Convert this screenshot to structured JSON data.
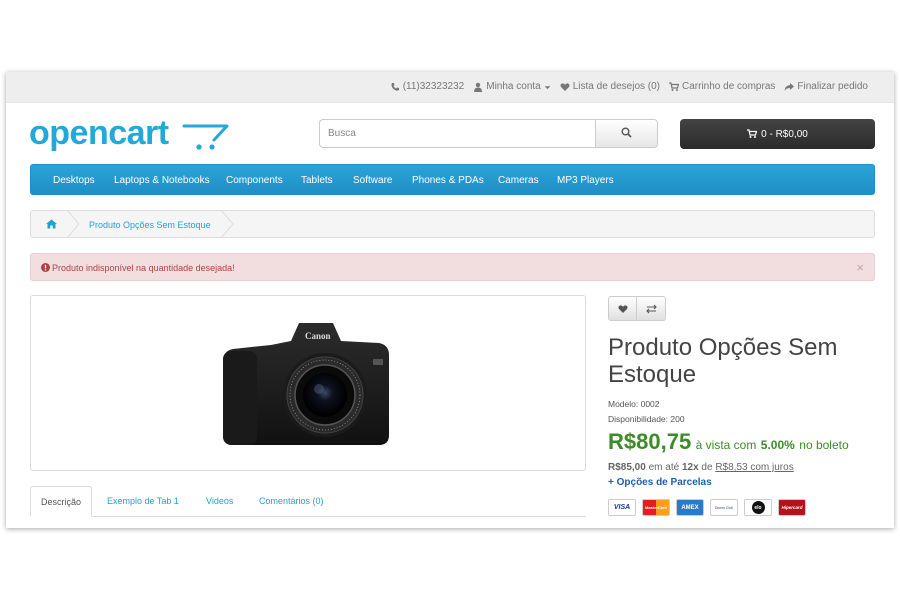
{
  "topbar": {
    "phone": "(11)32323232",
    "account": "Minha conta",
    "wishlist": "Lista de desejos (0)",
    "cart": "Carrinho de compras",
    "checkout": "Finalizar pedido"
  },
  "header": {
    "logo_text": "opencart",
    "search_placeholder": "Busca",
    "cart_button": "0 - R$0,00"
  },
  "menu": {
    "items": [
      "Desktops",
      "Laptops & Notebooks",
      "Components",
      "Tablets",
      "Software",
      "Phones & PDAs",
      "Cameras",
      "MP3 Players"
    ]
  },
  "breadcrumb": {
    "current": "Produto Opções Sem Estoque"
  },
  "alert": {
    "message": "Produto indisponível na quantidade desejada!",
    "close": "×"
  },
  "tabs": [
    "Descrição",
    "Exemplo de Tab 1",
    "Videos",
    "Comentários (0)"
  ],
  "product": {
    "title": "Produto Opções Sem Estoque",
    "model": "Modelo: 0002",
    "availability": "Disponibilidade: 200",
    "price": "R$80,75",
    "price_note_a": "à vista com",
    "price_note_pct": "5.00%",
    "price_note_b": "no boleto",
    "old_price": "R$85,00",
    "inst_a": "em até",
    "inst_count": "12x",
    "inst_b": "de",
    "inst_value": "R$8,53 com juros",
    "options_link": "+ Opções de Parcelas",
    "camera_brand": "Canon"
  },
  "cards": [
    "VISA",
    "MasterCard",
    "AMEX",
    "Diners Club",
    "elo",
    "Hipercard"
  ],
  "colors": {
    "menu": "#229ac8",
    "link": "#23a1d1",
    "price": "#3c8b27",
    "alert_bg": "#f2dede",
    "alert_text": "#a94442"
  }
}
